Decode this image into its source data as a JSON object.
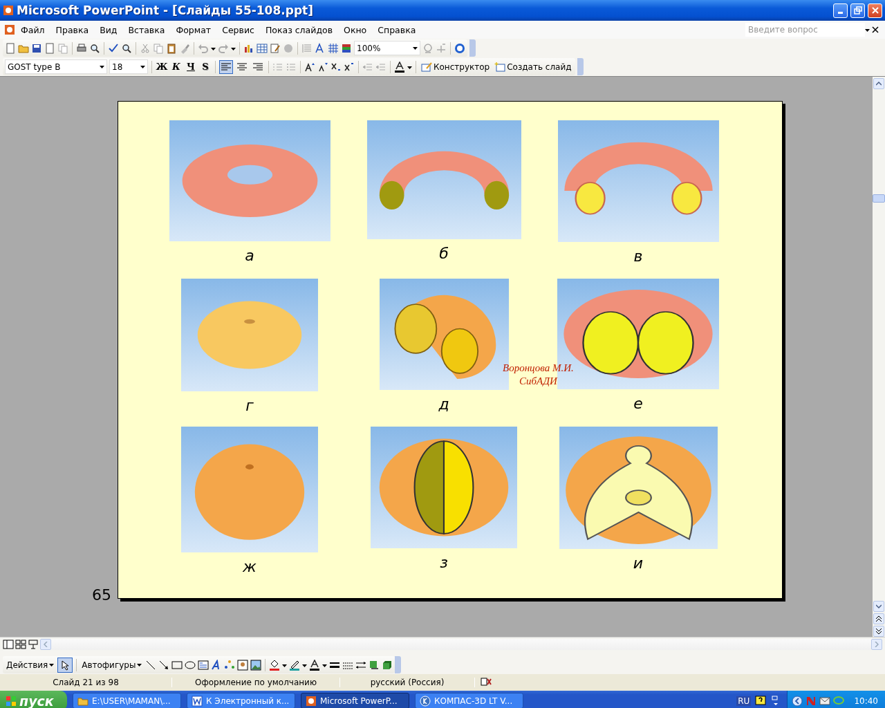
{
  "window": {
    "title": "Microsoft PowerPoint - [Слайды 55-108.ppt]"
  },
  "menu": [
    "Файл",
    "Правка",
    "Вид",
    "Вставка",
    "Формат",
    "Сервис",
    "Показ слайдов",
    "Окно",
    "Справка"
  ],
  "help_box": {
    "placeholder": "Введите вопрос"
  },
  "standard_toolbar": {
    "zoom": "100%"
  },
  "formatting_toolbar": {
    "font": "GOST type B",
    "size": "18",
    "styles": [
      "Ж",
      "К",
      "Ч",
      "S"
    ],
    "alignment": [
      {
        "kind": "left",
        "selected": true
      },
      {
        "kind": "center",
        "selected": false
      },
      {
        "kind": "right",
        "selected": false
      }
    ],
    "buttons": [
      "Конструктор",
      "Создать слайд"
    ]
  },
  "slide": {
    "number": "65",
    "author_note": [
      "Воронцова М.И.",
      "СибАДИ"
    ],
    "figures": [
      {
        "kind": "ring",
        "caption": "а"
      },
      {
        "kind": "half",
        "caption": "б"
      },
      {
        "kind": "half-open",
        "caption": "в"
      },
      {
        "kind": "apple",
        "caption": "г"
      },
      {
        "kind": "quarter",
        "caption": "д"
      },
      {
        "kind": "section",
        "caption": "е"
      },
      {
        "kind": "sphere",
        "caption": "ж"
      },
      {
        "kind": "sphere-cut",
        "caption": "з"
      },
      {
        "kind": "cutaway",
        "caption": "и"
      }
    ]
  },
  "drawing_toolbar": {
    "actions": "Действия",
    "autoshapes": "Автофигуры"
  },
  "status_bar": [
    "Слайд 21 из 98",
    "Оформление по умолчанию",
    "русский (Россия)"
  ],
  "taskbar": {
    "start": "пуск",
    "tasks": [
      {
        "label": "E:\\USER\\MAMAN\\...",
        "selected": false
      },
      {
        "label": "К Электронный к...",
        "selected": false
      },
      {
        "label": "Microsoft PowerP...",
        "selected": true
      },
      {
        "label": "КОМПАС-3D LT V...",
        "selected": false
      }
    ],
    "language": "RU",
    "time": "10:40"
  }
}
